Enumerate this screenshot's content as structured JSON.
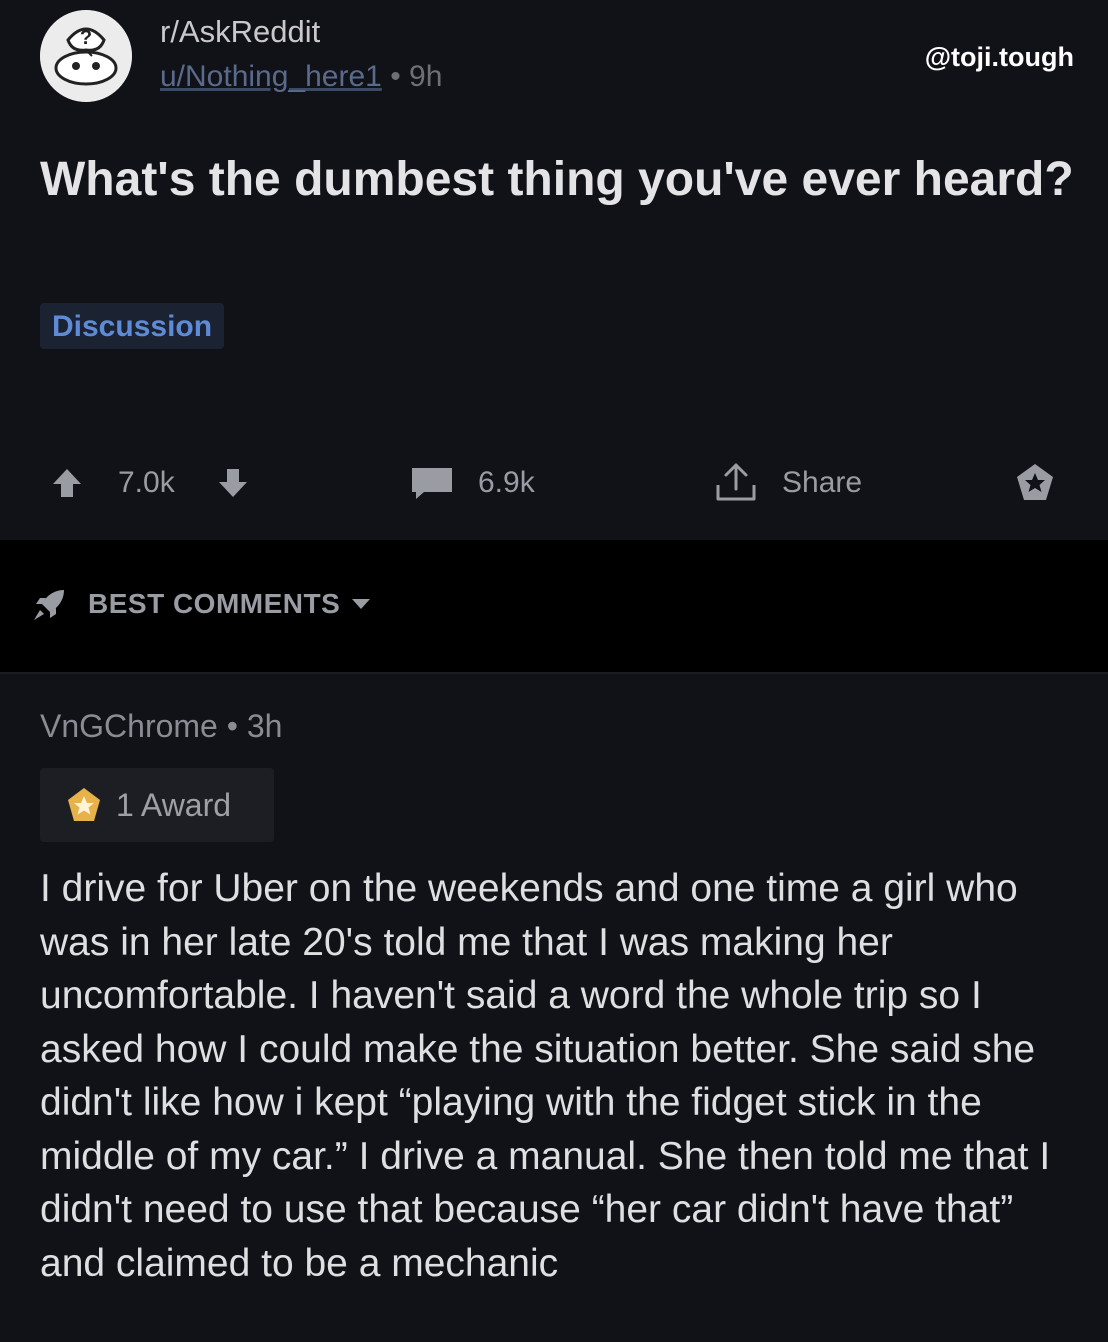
{
  "post": {
    "subreddit": "r/AskReddit",
    "username": "u/Nothing_here1",
    "separator": "•",
    "age": "9h",
    "title": "What's the dumbest thing you've ever heard?",
    "flair": "Discussion",
    "upvotes": "7.0k",
    "comments": "6.9k",
    "share_label": "Share"
  },
  "watermark": "@toji.tough",
  "sort": {
    "label": "BEST COMMENTS"
  },
  "comment": {
    "username": "VnGChrome",
    "separator": "•",
    "age": "3h",
    "award_label": "1 Award",
    "body": "I drive for Uber on the weekends and one time a girl who was in her late 20's told me that I was making her uncomfortable. I haven't said a word the whole trip so I asked how I could make the situation better. She said she didn't like how i kept “playing with the fidget stick in the middle of my car.” I drive a manual. She then told me that I didn't need to use that because “her car didn't have that” and claimed to be a mechanic"
  },
  "colors": {
    "background": "#111118",
    "divider": "#000000",
    "flair_text": "#5f8bd6",
    "flair_bg": "#1b2333",
    "muted": "#9a9ca4"
  },
  "icons": [
    "subreddit-avatar",
    "upvote-icon",
    "downvote-icon",
    "comment-icon",
    "share-icon",
    "award-icon",
    "rocket-icon",
    "caret-down-icon",
    "award-badge-icon"
  ]
}
